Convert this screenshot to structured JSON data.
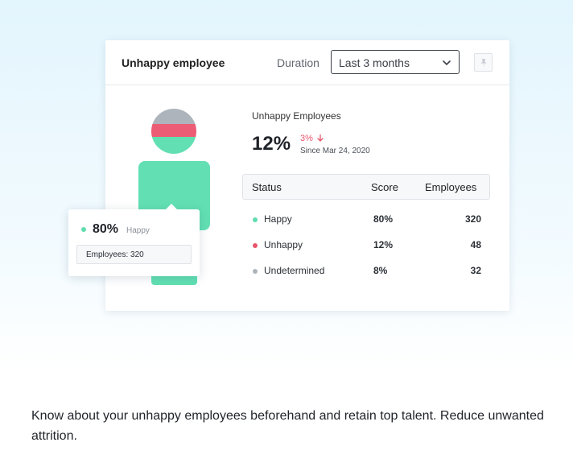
{
  "card": {
    "title": "Unhappy employee",
    "duration_label": "Duration",
    "duration_value": "Last 3 months"
  },
  "stats": {
    "title": "Unhappy Employees",
    "percent": "12%",
    "delta": "3%",
    "delta_direction": "down",
    "since": "Since Mar 24, 2020"
  },
  "table": {
    "headers": [
      "Status",
      "Score",
      "Employees"
    ],
    "rows": [
      {
        "status": "Happy",
        "score": "80%",
        "employees": "320",
        "color": "#5fdcae"
      },
      {
        "status": "Unhappy",
        "score": "12%",
        "employees": "48",
        "color": "#e8566c"
      },
      {
        "status": "Undetermined",
        "score": "8%",
        "employees": "32",
        "color": "#adb4bc"
      }
    ]
  },
  "tooltip": {
    "percent": "80%",
    "label": "Happy",
    "employees": "Employees: 320"
  },
  "colors": {
    "happy": "#62e0b3",
    "unhappy": "#ec5d75",
    "undetermined": "#adb4bc",
    "delta": "#e8566c"
  },
  "tagline": "Know about your unhappy employees beforehand and retain top talent. Reduce unwanted attrition."
}
